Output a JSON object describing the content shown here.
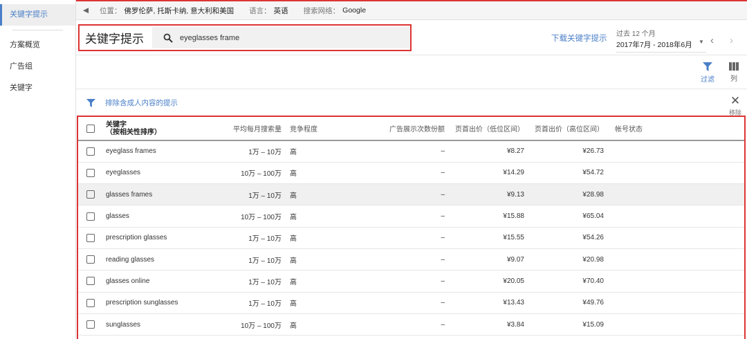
{
  "sidebar": {
    "items": [
      "关键字提示",
      "方案概览",
      "广告组",
      "关键字"
    ]
  },
  "context": {
    "location_label": "位置：",
    "location": "佛罗伦萨, 托斯卡纳, 意大利和美国",
    "language_label": "语言：",
    "language": "英语",
    "network_label": "搜索网络：",
    "network": "Google"
  },
  "header": {
    "title": "关键字提示",
    "search_value": "eyeglasses frame",
    "download": "下载关键字提示",
    "range_label": "过去 12 个月",
    "range": "2017年7月 - 2018年6月"
  },
  "toolbar": {
    "filter": "过滤",
    "columns": "列",
    "exclude": "排除含成人内容的提示",
    "remove": "移除"
  },
  "colors": {
    "accent": "#4a7fc8",
    "highlight": "#d33333"
  },
  "table": {
    "headers": {
      "keyword": "关键字",
      "keyword_sub": "（按相关性排序）",
      "volume": "平均每月搜索量",
      "competition": "竞争程度",
      "impr_share": "广告展示次数份额",
      "bid_low": "页首出价（低位区间）",
      "bid_high": "页首出价（高位区间）",
      "status": "帐号状态"
    },
    "rows": [
      {
        "keyword": "eyeglass frames",
        "volume": "1万 – 10万",
        "competition": "高",
        "impr_share": "–",
        "bid_low": "¥8.27",
        "bid_high": "¥26.73"
      },
      {
        "keyword": "eyeglasses",
        "volume": "10万 – 100万",
        "competition": "高",
        "impr_share": "–",
        "bid_low": "¥14.29",
        "bid_high": "¥54.72"
      },
      {
        "keyword": "glasses frames",
        "volume": "1万 – 10万",
        "competition": "高",
        "impr_share": "–",
        "bid_low": "¥9.13",
        "bid_high": "¥28.98"
      },
      {
        "keyword": "glasses",
        "volume": "10万 – 100万",
        "competition": "高",
        "impr_share": "–",
        "bid_low": "¥15.88",
        "bid_high": "¥65.04"
      },
      {
        "keyword": "prescription glasses",
        "volume": "1万 – 10万",
        "competition": "高",
        "impr_share": "–",
        "bid_low": "¥15.55",
        "bid_high": "¥54.26"
      },
      {
        "keyword": "reading glasses",
        "volume": "1万 – 10万",
        "competition": "高",
        "impr_share": "–",
        "bid_low": "¥9.07",
        "bid_high": "¥20.98"
      },
      {
        "keyword": "glasses online",
        "volume": "1万 – 10万",
        "competition": "高",
        "impr_share": "–",
        "bid_low": "¥20.05",
        "bid_high": "¥70.40"
      },
      {
        "keyword": "prescription sunglasses",
        "volume": "1万 – 10万",
        "competition": "高",
        "impr_share": "–",
        "bid_low": "¥13.43",
        "bid_high": "¥49.76"
      },
      {
        "keyword": "sunglasses",
        "volume": "10万 – 100万",
        "competition": "高",
        "impr_share": "–",
        "bid_low": "¥3.84",
        "bid_high": "¥15.09"
      }
    ]
  }
}
